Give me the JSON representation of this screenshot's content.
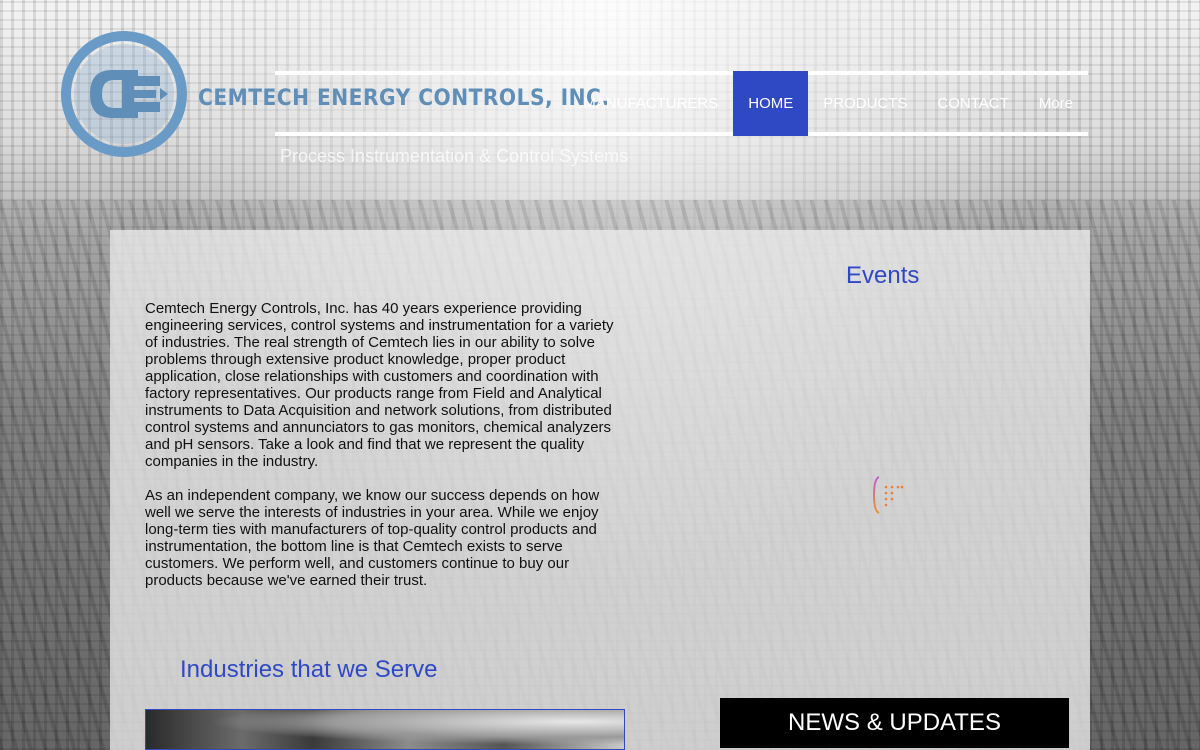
{
  "header": {
    "brand_name": "CEMTECH ENERGY CONTROLS, INC.",
    "tagline": "Process Instrumentation & Control Systems"
  },
  "nav": {
    "items": [
      {
        "label": "MANUFACTURERS"
      },
      {
        "label": "HOME",
        "active": true
      },
      {
        "label": "PRODUCTS"
      },
      {
        "label": "CONTACT"
      },
      {
        "label": "More"
      }
    ]
  },
  "main": {
    "paragraphs": [
      " Cemtech Energy Controls, Inc. has 40 years experience providing engineering services, control systems and instrumentation for a variety of industries. The real strength of Cemtech lies in our ability to solve problems through extensive product knowledge, proper product application, close relationships with customers and coordination with factory representatives. Our products range from Field and Analytical instruments to Data Acquisition and network solutions, from distributed control systems and annunciators to gas monitors, chemical analyzers and pH sensors. Take a look and find that we represent the quality companies in the industry.",
      "As an independent company, we know our success depends on how well we serve the interests of industries in your area. While we enjoy long-term ties with manufacturers of top-quality control products and instrumentation, the bottom line is that Cemtech exists to serve customers. We perform well, and customers continue to buy our products because we've earned their trust."
    ],
    "industries_title": "Industries that we Serve"
  },
  "sidebar": {
    "events_title": "Events",
    "news_label": "NEWS & UPDATES"
  },
  "colors": {
    "accent": "#2f49c4",
    "logo_blue": "#5f8fb8",
    "news_bg": "#000000"
  }
}
